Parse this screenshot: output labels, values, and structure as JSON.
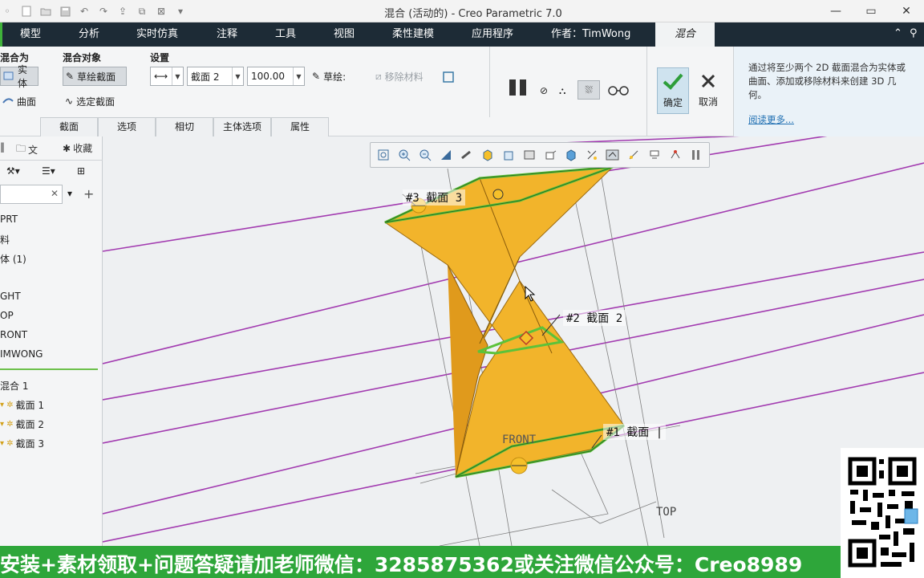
{
  "window": {
    "title": "混合 (活动的) - Creo Parametric 7.0"
  },
  "tabs": [
    {
      "label": "模型"
    },
    {
      "label": "分析"
    },
    {
      "label": "实时仿真"
    },
    {
      "label": "注释"
    },
    {
      "label": "工具"
    },
    {
      "label": "视图"
    },
    {
      "label": "柔性建模"
    },
    {
      "label": "应用程序"
    },
    {
      "label": "作者：TimWong"
    },
    {
      "label": "混合"
    }
  ],
  "ribbon": {
    "blend_as": {
      "label": "混合为",
      "solid": "实体",
      "surface": "曲面"
    },
    "blend_object": {
      "label": "混合对象",
      "sketch_section": "草绘截面",
      "selected_section": "选定截面"
    },
    "settings": {
      "label": "设置",
      "section_value": "截面 2",
      "offset_value": "100.00",
      "sketch_label": "草绘:",
      "remove_material": "移除材料"
    },
    "ok_label": "确定",
    "cancel_label": "取消",
    "subtabs": [
      "截面",
      "选项",
      "相切",
      "主体选项",
      "属性"
    ],
    "help_text": "通过将至少两个 2D 截面混合为实体或曲面、添加或移除材料来创建 3D 几何。",
    "help_link": "阅读更多..."
  },
  "left_panel": {
    "tab1": "文",
    "tab2": "收藏",
    "tree": [
      "PRT",
      "料",
      "体 (1)",
      "GHT",
      "OP",
      "RONT",
      "IMWONG",
      "混合 1",
      "截面 1",
      "截面 2",
      "截面 3"
    ]
  },
  "viewport": {
    "labels": {
      "section3": "#3  截面  3",
      "section2": "#2  截面  2",
      "section1": "#1  截面  |",
      "front": "FRONT",
      "top": "TOP"
    }
  },
  "banner": {
    "text": "安装+素材领取+问题答疑请加老师微信：3285875362或关注微信公众号：Creo8989"
  },
  "colors": {
    "tab_bar": "#1d2b36",
    "banner": "#2ea63a",
    "solid": "#f2b42b",
    "datum_curve": "#a23bb0",
    "section_outline": "#5cc23a"
  }
}
